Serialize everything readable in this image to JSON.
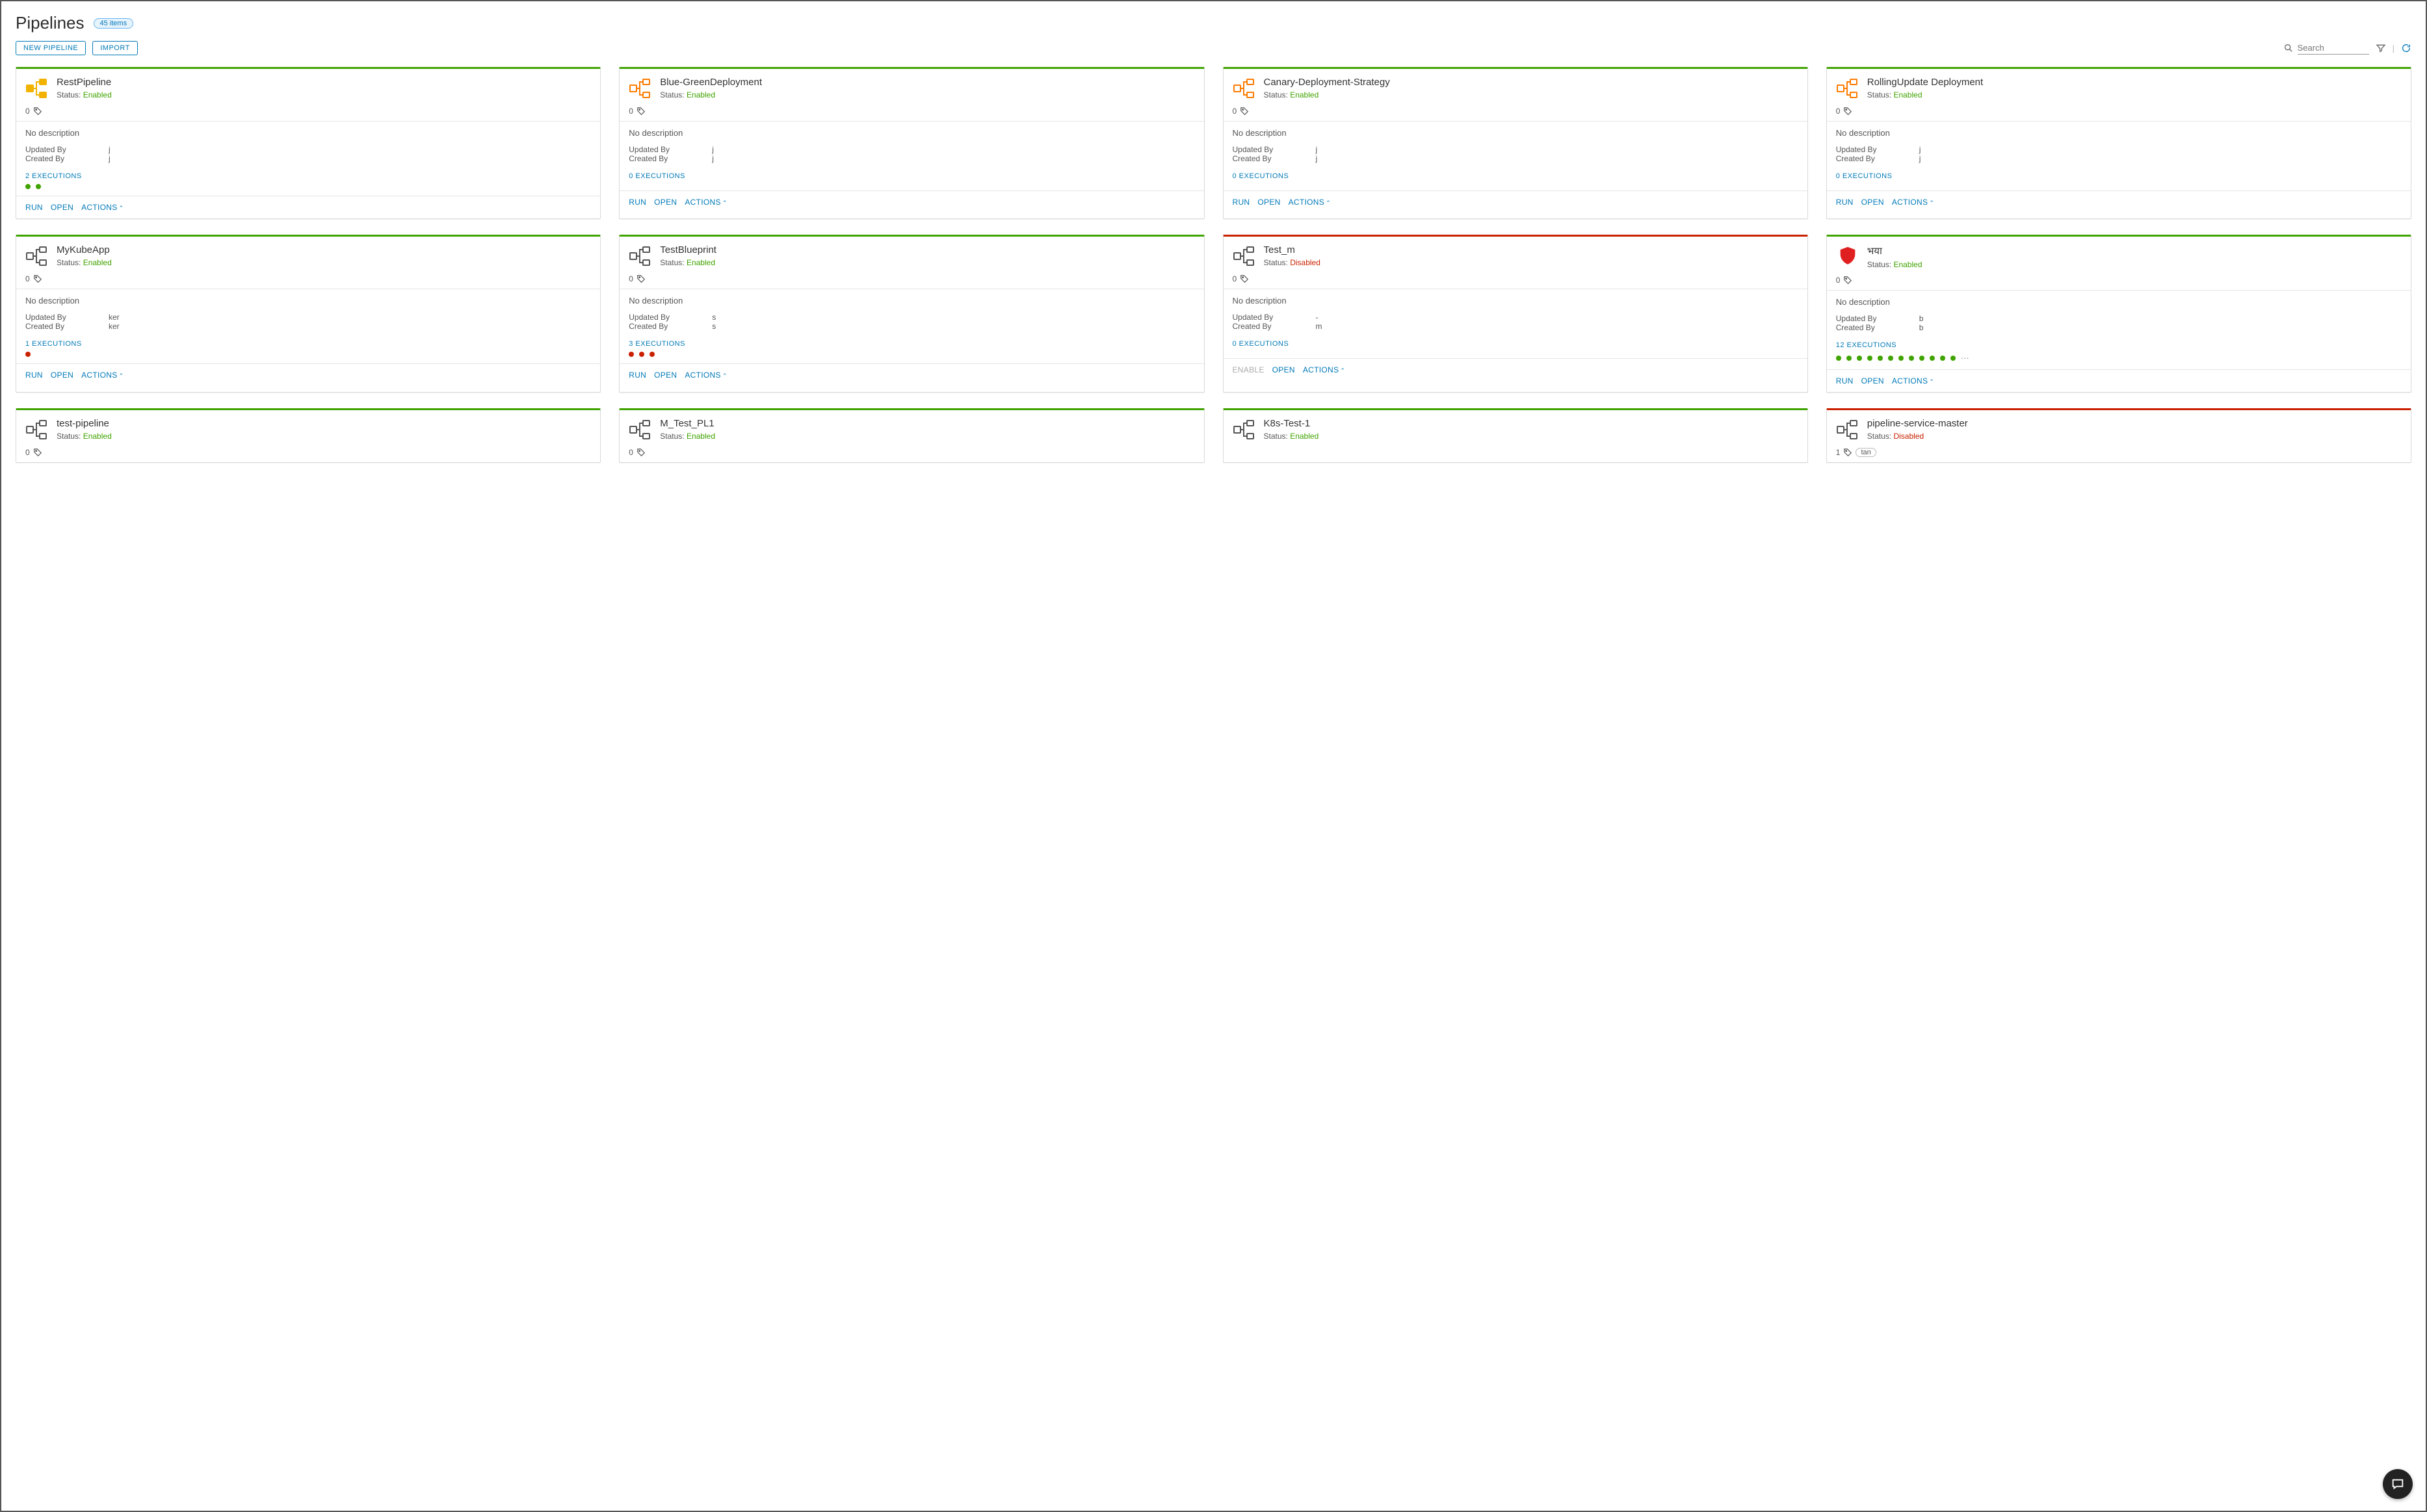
{
  "header": {
    "title": "Pipelines",
    "count_label": "45 items"
  },
  "toolbar": {
    "new_pipeline": "NEW PIPELINE",
    "import": "IMPORT",
    "search_placeholder": "Search"
  },
  "labels": {
    "status_prefix": "Status:",
    "updated_by": "Updated By",
    "created_by": "Created By",
    "run": "RUN",
    "open": "OPEN",
    "actions": "ACTIONS",
    "enable": "ENABLE",
    "no_description": "No description"
  },
  "cards": [
    {
      "name": "RestPipeline",
      "status": "Enabled",
      "icon": "org-yellow",
      "tags_count": 0,
      "tags": [],
      "description": "No description",
      "updated_by": "j",
      "created_by": "j",
      "executions_count": 2,
      "dots": [
        "green",
        "green"
      ],
      "actions": [
        "RUN",
        "OPEN",
        "ACTIONS"
      ]
    },
    {
      "name": "Blue-GreenDeployment",
      "status": "Enabled",
      "icon": "org-orange",
      "tags_count": 0,
      "tags": [],
      "description": "No description",
      "updated_by": "j",
      "created_by": "j",
      "executions_count": 0,
      "dots": [],
      "actions": [
        "RUN",
        "OPEN",
        "ACTIONS"
      ]
    },
    {
      "name": "Canary-Deployment-Strategy",
      "status": "Enabled",
      "icon": "org-orange",
      "tags_count": 0,
      "tags": [],
      "description": "No description",
      "updated_by": "j",
      "created_by": "j",
      "executions_count": 0,
      "dots": [],
      "actions": [
        "RUN",
        "OPEN",
        "ACTIONS"
      ]
    },
    {
      "name": "RollingUpdate Deployment",
      "status": "Enabled",
      "icon": "org-orange",
      "tags_count": 0,
      "tags": [],
      "description": "No description",
      "updated_by": "j",
      "created_by": "j",
      "executions_count": 0,
      "dots": [],
      "actions": [
        "RUN",
        "OPEN",
        "ACTIONS"
      ]
    },
    {
      "name": "MyKubeApp",
      "status": "Enabled",
      "icon": "org-gray",
      "tags_count": 0,
      "tags": [],
      "description": "No description",
      "updated_by": "ker",
      "created_by": "ker",
      "executions_count": 1,
      "dots": [
        "red"
      ],
      "actions": [
        "RUN",
        "OPEN",
        "ACTIONS"
      ]
    },
    {
      "name": "TestBlueprint",
      "status": "Enabled",
      "icon": "org-gray",
      "tags_count": 0,
      "tags": [],
      "description": "No description",
      "updated_by": "s",
      "created_by": "s",
      "executions_count": 3,
      "dots": [
        "red",
        "red",
        "red"
      ],
      "actions": [
        "RUN",
        "OPEN",
        "ACTIONS"
      ]
    },
    {
      "name": "Test_m",
      "status": "Disabled",
      "icon": "org-gray",
      "tags_count": 0,
      "tags": [],
      "description": "No description",
      "updated_by": "-",
      "created_by": "m",
      "executions_count": 0,
      "dots": [],
      "actions": [
        "ENABLE",
        "OPEN",
        "ACTIONS"
      ]
    },
    {
      "name": "भया",
      "status": "Enabled",
      "icon": "shield-red",
      "tags_count": 0,
      "tags": [],
      "description": "No description",
      "updated_by": "b",
      "created_by": "b",
      "executions_count": 12,
      "dots": [
        "green",
        "green",
        "green",
        "green",
        "green",
        "green",
        "green",
        "green",
        "green",
        "green",
        "green",
        "green"
      ],
      "dots_more": true,
      "actions": [
        "RUN",
        "OPEN",
        "ACTIONS"
      ]
    },
    {
      "name": "test-pipeline",
      "status": "Enabled",
      "icon": "org-gray",
      "tags_count": 0,
      "tags": [],
      "partial": true
    },
    {
      "name": "M_Test_PL1",
      "status": "Enabled",
      "icon": "org-gray",
      "tags_count": 0,
      "tags": [],
      "partial": true
    },
    {
      "name": "K8s-Test-1",
      "status": "Enabled",
      "icon": "org-gray",
      "tags_count": 0,
      "tags": [],
      "partial": true,
      "hide_tags": true
    },
    {
      "name": "pipeline-service-master",
      "status": "Disabled",
      "icon": "org-gray",
      "tags_count": 1,
      "tags": [
        "tan"
      ],
      "partial": true
    }
  ]
}
